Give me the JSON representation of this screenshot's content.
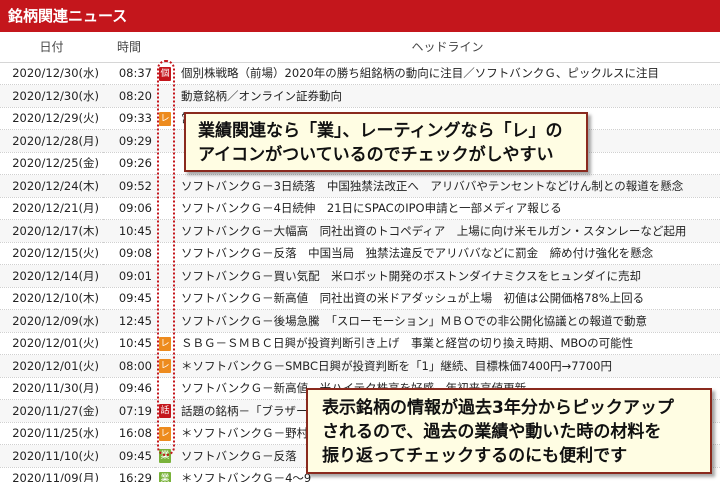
{
  "app": {
    "title": "銘柄関連ニュース"
  },
  "columns": {
    "date": "日付",
    "time": "時間",
    "headline": "ヘッドライン"
  },
  "badge_colors": {
    "個": "#c4161c",
    "レ": "#ed8b1e",
    "話": "#c4161c",
    "業": "#79b23a"
  },
  "rows": [
    {
      "date": "2020/12/30(水)",
      "time": "08:37",
      "badge": "個",
      "headline": "個別株戦略（前場）2020年の勝ち組銘柄の動向に注目／ソフトバンクＧ、ピックルスに注目"
    },
    {
      "date": "2020/12/30(水)",
      "time": "08:20",
      "badge": "",
      "headline": "動意銘柄／オンライン証券動向"
    },
    {
      "date": "2020/12/29(火)",
      "time": "09:33",
      "badge": "レ",
      "headline": "営を実行"
    },
    {
      "date": "2020/12/28(月)",
      "time": "09:29",
      "badge": "",
      "headline": ""
    },
    {
      "date": "2020/12/25(金)",
      "time": "09:26",
      "badge": "",
      "headline": ""
    },
    {
      "date": "2020/12/24(木)",
      "time": "09:52",
      "badge": "",
      "headline": "ソフトバンクＧ－3日続落　中国独禁法改正へ　アリババやテンセントなどけん制との報道を懸念"
    },
    {
      "date": "2020/12/21(月)",
      "time": "09:06",
      "badge": "",
      "headline": "ソフトバンクＧ－4日続伸　21日にSPACのIPO申請と一部メディア報じる"
    },
    {
      "date": "2020/12/17(木)",
      "time": "10:45",
      "badge": "",
      "headline": "ソフトバンクＧ－大幅高　同社出資のトコペディア　上場に向け米モルガン・スタンレーなど起用"
    },
    {
      "date": "2020/12/15(火)",
      "time": "09:08",
      "badge": "",
      "headline": "ソフトバンクＧ－反落　中国当局　独禁法違反でアリババなどに罰金　締め付け強化を懸念"
    },
    {
      "date": "2020/12/14(月)",
      "time": "09:01",
      "badge": "",
      "headline": "ソフトバンクＧ－買い気配　米ロボット開発のボストンダイナミクスをヒュンダイに売却"
    },
    {
      "date": "2020/12/10(木)",
      "time": "09:45",
      "badge": "",
      "headline": "ソフトバンクＧ－新高値　同社出資の米ドアダッシュが上場　初値は公開価格78%上回る"
    },
    {
      "date": "2020/12/09(水)",
      "time": "12:45",
      "badge": "",
      "headline": "ソフトバンクＧ－後場急騰　「スローモーション」ＭＢＯでの非公開化協議との報道で動意"
    },
    {
      "date": "2020/12/01(火)",
      "time": "10:45",
      "badge": "レ",
      "headline": "ＳＢＧ－ＳＭＢＣ日興が投資判断引き上げ　事業と経営の切り換え時期、MBOの可能性"
    },
    {
      "date": "2020/12/01(火)",
      "time": "08:00",
      "badge": "レ",
      "headline": "＊ソフトバンクＧ－SMBC日興が投資判断を「1」継続、目標株価7400円→7700円"
    },
    {
      "date": "2020/11/30(月)",
      "time": "09:46",
      "badge": "",
      "headline": "ソフトバンクＧ－新高値　米ハイテク株高を好感　年初来高値更新"
    },
    {
      "date": "2020/11/27(金)",
      "time": "07:19",
      "badge": "話",
      "headline": "話題の銘柄－「ブラザー"
    },
    {
      "date": "2020/11/25(水)",
      "time": "16:08",
      "badge": "レ",
      "headline": "＊ソフトバンクＧ－野村"
    },
    {
      "date": "2020/11/10(火)",
      "time": "09:45",
      "badge": "業",
      "headline": "ソフトバンクＧ－反落"
    },
    {
      "date": "2020/11/09(月)",
      "time": "16:29",
      "badge": "業",
      "headline": "＊ソフトバンクＧ－4～9"
    }
  ],
  "callouts": {
    "icons_tip": {
      "line1": "業績関連なら「業」、レーティングなら「レ」の",
      "line2": "アイコンがついているのでチェックがしやすい"
    },
    "history_tip": {
      "line1": "表示銘柄の情報が過去3年分からピックアップ",
      "line2": "されるので、過去の業績や動いた時の材料を",
      "line3": "振り返ってチェックするのにも便利です"
    }
  }
}
